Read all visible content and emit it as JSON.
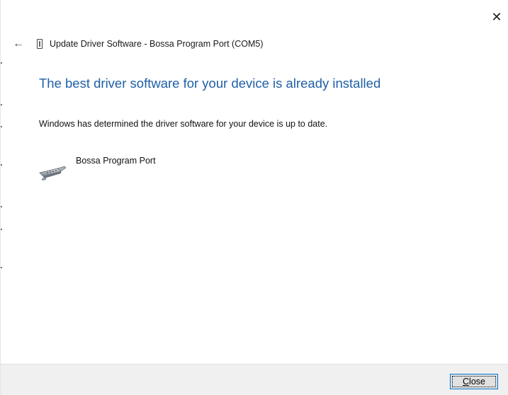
{
  "window": {
    "close_glyph": "✕"
  },
  "titlebar": {
    "back_icon": "back-arrow-icon",
    "device_icon": "device-icon",
    "title": "Update Driver Software - Bossa Program Port (COM5)"
  },
  "content": {
    "heading": "The best driver software for your device is already installed",
    "message": "Windows has determined the driver software for your device is up to date.",
    "device": {
      "icon": "serial-port-icon",
      "name": "Bossa Program Port"
    }
  },
  "footer": {
    "close_button": {
      "mnemonic": "C",
      "rest": "lose"
    }
  },
  "colors": {
    "heading": "#1f5fa6",
    "button_border": "#0078d7",
    "footer_bg": "#f0f0f0"
  }
}
